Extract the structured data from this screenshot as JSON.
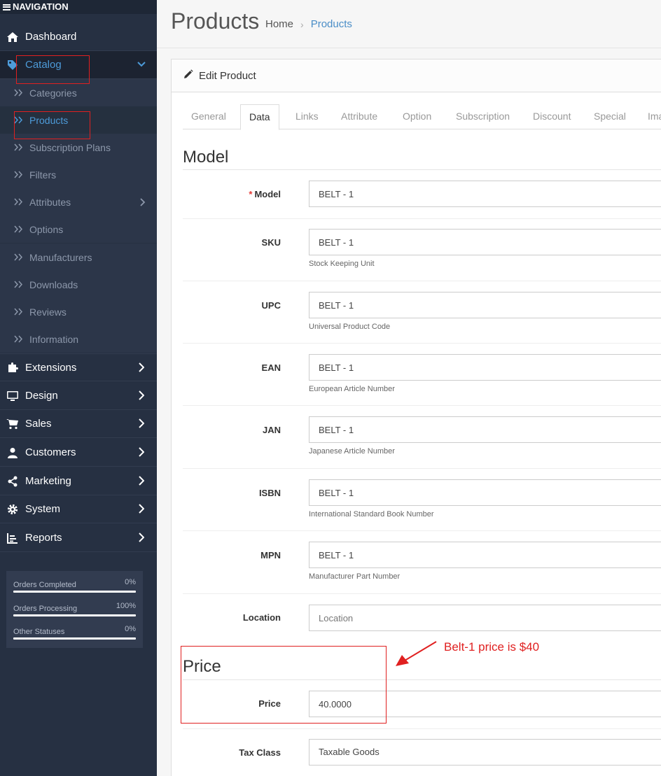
{
  "sidebar": {
    "header": "NAVIGATION",
    "items": [
      {
        "label": "Dashboard"
      },
      {
        "label": "Catalog"
      },
      {
        "label": "Extensions"
      },
      {
        "label": "Design"
      },
      {
        "label": "Sales"
      },
      {
        "label": "Customers"
      },
      {
        "label": "Marketing"
      },
      {
        "label": "System"
      },
      {
        "label": "Reports"
      }
    ],
    "catalog_sub": [
      {
        "label": "Categories"
      },
      {
        "label": "Products"
      },
      {
        "label": "Subscription Plans"
      },
      {
        "label": "Filters"
      },
      {
        "label": "Attributes"
      },
      {
        "label": "Options"
      },
      {
        "label": "Manufacturers"
      },
      {
        "label": "Downloads"
      },
      {
        "label": "Reviews"
      },
      {
        "label": "Information"
      }
    ],
    "stats": [
      {
        "label": "Orders Completed",
        "pct": "0%",
        "value": 0
      },
      {
        "label": "Orders Processing",
        "pct": "100%",
        "value": 100
      },
      {
        "label": "Other Statuses",
        "pct": "0%",
        "value": 0
      }
    ]
  },
  "header": {
    "title": "Products",
    "breadcrumb": [
      "Home",
      "Products"
    ]
  },
  "card": {
    "title": "Edit Product",
    "tabs": [
      "General",
      "Data",
      "Links",
      "Attribute",
      "Option",
      "Subscription",
      "Discount",
      "Special",
      "Ima"
    ]
  },
  "model_section": {
    "title": "Model",
    "fields": [
      {
        "label": "Model",
        "value": "BELT - 1",
        "help": ""
      },
      {
        "label": "SKU",
        "value": "BELT - 1",
        "help": "Stock Keeping Unit"
      },
      {
        "label": "UPC",
        "value": "BELT - 1",
        "help": "Universal Product Code"
      },
      {
        "label": "EAN",
        "value": "BELT - 1",
        "help": "European Article Number"
      },
      {
        "label": "JAN",
        "value": "BELT - 1",
        "help": "Japanese Article Number"
      },
      {
        "label": "ISBN",
        "value": "BELT - 1",
        "help": "International Standard Book Number"
      },
      {
        "label": "MPN",
        "value": "BELT - 1",
        "help": "Manufacturer Part Number"
      },
      {
        "label": "Location",
        "value": "",
        "placeholder": "Location",
        "help": ""
      }
    ]
  },
  "price_section": {
    "title": "Price",
    "price_label": "Price",
    "price_value": "40.0000",
    "tax_label": "Tax Class",
    "tax_value": "Taxable Goods"
  },
  "annotation": {
    "text": "Belt-1 price is $40",
    "color": "#e02020"
  },
  "colors": {
    "sidebar_bg": "#263042",
    "accent": "#4d9bd9",
    "required": "#e53935"
  }
}
